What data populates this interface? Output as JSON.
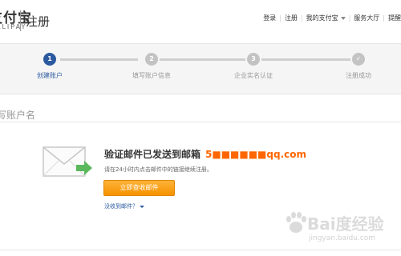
{
  "header": {
    "logo_cn": "支付宝",
    "logo_en": "ALIPAY",
    "page_name": "注册",
    "nav": {
      "login": "登录",
      "register": "注册",
      "my_alipay": "我的支付宝",
      "service": "服务大厅",
      "more": "提醒"
    }
  },
  "progress": {
    "steps": [
      {
        "number": "1",
        "label": "创建账户",
        "state": "active"
      },
      {
        "number": "2",
        "label": "填写账户信息",
        "state": "todo"
      },
      {
        "number": "3",
        "label": "企业实名认证",
        "state": "todo"
      },
      {
        "number": "✓",
        "label": "注册成功",
        "state": "todo"
      }
    ]
  },
  "section": {
    "title": "写账户名"
  },
  "main": {
    "headline": "验证邮件已发送到邮箱",
    "email": "5■■■■■■qq.com",
    "subtext": "请在24小时内点击邮件中的链接继续注册。",
    "check_button": "立即查收邮件",
    "no_receive_link": "没收到邮件？"
  },
  "colors": {
    "brand_blue": "#2c5aa0",
    "accent_orange": "#f60",
    "button_orange": "#f59200",
    "envelope_arrow": "#5cb85c"
  },
  "watermark": {
    "text": "Bai度经验",
    "url": "jingyan.baidu.com"
  }
}
